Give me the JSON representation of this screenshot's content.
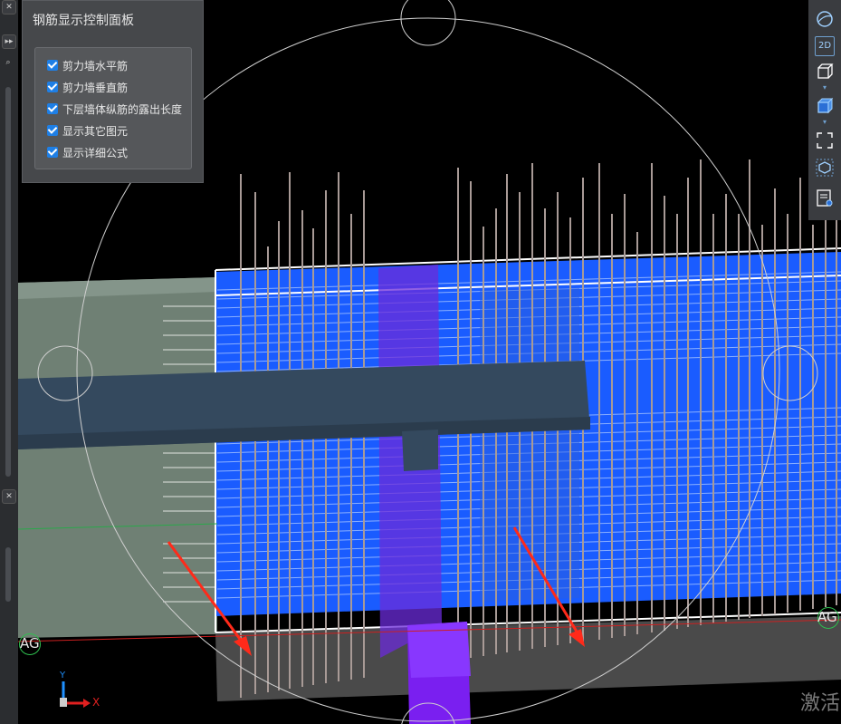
{
  "panel": {
    "title": "钢筋显示控制面板",
    "options": [
      {
        "label": "剪力墙水平筋",
        "checked": true
      },
      {
        "label": "剪力墙垂直筋",
        "checked": true
      },
      {
        "label": "下层墙体纵筋的露出长度",
        "checked": true
      },
      {
        "label": "显示其它图元",
        "checked": true
      },
      {
        "label": "显示详细公式",
        "checked": true
      }
    ]
  },
  "toolbar": {
    "items": [
      {
        "name": "orbit-view",
        "icon": "sphere-icon"
      },
      {
        "name": "2d-view",
        "icon": "2d-icon",
        "text": "2D"
      },
      {
        "name": "3d-box-view",
        "icon": "cube-outline-icon"
      },
      {
        "name": "3d-solid-view",
        "icon": "cube-solid-icon"
      },
      {
        "name": "fit-extent",
        "icon": "frame-corners-icon"
      },
      {
        "name": "select-element",
        "icon": "hex-cube-icon"
      },
      {
        "name": "properties",
        "icon": "doc-eye-icon"
      }
    ]
  },
  "viewport": {
    "axis_label_left": "AG",
    "axis_label_right": "AG",
    "axis_x": "X",
    "axis_y": "Y",
    "watermark": "激活"
  },
  "colors": {
    "wall_blue": "#1a5cff",
    "column_purple": "#6b2bd9",
    "beam_slate": "#34495e",
    "rebar_gray": "#a89a96",
    "arrow_red": "#ff2a1a",
    "slab_green": "#6f8074"
  }
}
